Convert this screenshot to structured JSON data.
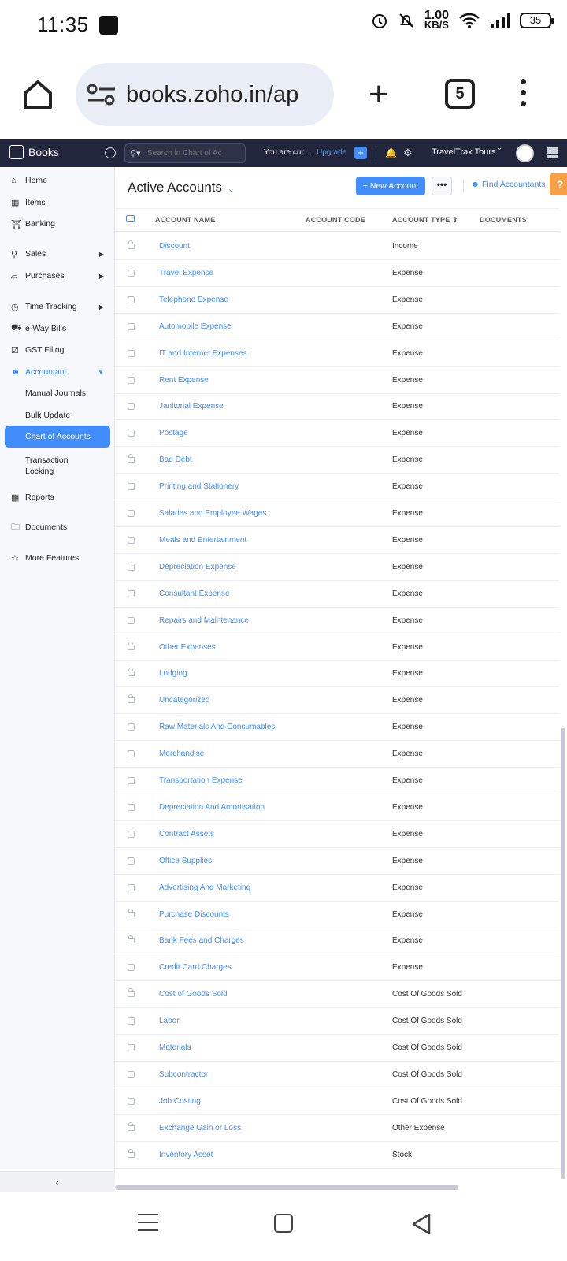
{
  "status_bar": {
    "time": "11:35",
    "speed_top": "1.00",
    "speed_unit": "KB/S",
    "battery": "35"
  },
  "browser": {
    "url": "books.zoho.in/ap",
    "tab_count": "5"
  },
  "app_header": {
    "app_name": "Books",
    "search_placeholder": "Search in Chart of Ac",
    "trial_text": "You are cur...",
    "upgrade_label": "Upgrade",
    "org_name": "TravelTrax Tours"
  },
  "sidebar": {
    "items": [
      {
        "label": "Home",
        "icon": "home-icon"
      },
      {
        "label": "Items",
        "icon": "items-icon"
      },
      {
        "label": "Banking",
        "icon": "bank-icon"
      },
      {
        "label": "Sales",
        "icon": "cart-icon"
      },
      {
        "label": "Purchases",
        "icon": "bag-icon"
      },
      {
        "label": "Time Tracking",
        "icon": "clock-icon"
      },
      {
        "label": "e-Way Bills",
        "icon": "truck-icon"
      },
      {
        "label": "GST Filing",
        "icon": "gst-icon"
      },
      {
        "label": "Accountant",
        "icon": "accountant-icon"
      },
      {
        "label": "Manual Journals"
      },
      {
        "label": "Bulk Update"
      },
      {
        "label": "Chart of Accounts"
      },
      {
        "label": "Transaction Locking"
      },
      {
        "label": "Reports",
        "icon": "reports-icon"
      },
      {
        "label": "Documents",
        "icon": "folder-icon"
      },
      {
        "label": "More Features",
        "icon": "star-icon"
      }
    ]
  },
  "main": {
    "title": "Active Accounts",
    "new_account_label": "+ New Account",
    "more_label": "•••",
    "find_accountants_label": "Find Accountants",
    "help_label": "?",
    "columns": [
      "ACCOUNT NAME",
      "ACCOUNT CODE",
      "ACCOUNT TYPE",
      "DOCUMENTS"
    ],
    "rows": [
      {
        "name": "Discount",
        "type": "Income",
        "locked": true
      },
      {
        "name": "Travel Expense",
        "type": "Expense",
        "locked": false
      },
      {
        "name": "Telephone Expense",
        "type": "Expense",
        "locked": false
      },
      {
        "name": "Automobile Expense",
        "type": "Expense",
        "locked": false
      },
      {
        "name": "IT and Internet Expenses",
        "type": "Expense",
        "locked": false
      },
      {
        "name": "Rent Expense",
        "type": "Expense",
        "locked": false
      },
      {
        "name": "Janitorial Expense",
        "type": "Expense",
        "locked": false
      },
      {
        "name": "Postage",
        "type": "Expense",
        "locked": false
      },
      {
        "name": "Bad Debt",
        "type": "Expense",
        "locked": true
      },
      {
        "name": "Printing and Stationery",
        "type": "Expense",
        "locked": false
      },
      {
        "name": "Salaries and Employee Wages",
        "type": "Expense",
        "locked": false
      },
      {
        "name": "Meals and Entertainment",
        "type": "Expense",
        "locked": false
      },
      {
        "name": "Depreciation Expense",
        "type": "Expense",
        "locked": false
      },
      {
        "name": "Consultant Expense",
        "type": "Expense",
        "locked": false
      },
      {
        "name": "Repairs and Maintenance",
        "type": "Expense",
        "locked": false
      },
      {
        "name": "Other Expenses",
        "type": "Expense",
        "locked": true
      },
      {
        "name": "Lodging",
        "type": "Expense",
        "locked": true
      },
      {
        "name": "Uncategorized",
        "type": "Expense",
        "locked": true
      },
      {
        "name": "Raw Materials And Consumables",
        "type": "Expense",
        "locked": false
      },
      {
        "name": "Merchandise",
        "type": "Expense",
        "locked": false
      },
      {
        "name": "Transportation Expense",
        "type": "Expense",
        "locked": false
      },
      {
        "name": "Depreciation And Amortisation",
        "type": "Expense",
        "locked": false
      },
      {
        "name": "Contract Assets",
        "type": "Expense",
        "locked": false
      },
      {
        "name": "Office Supplies",
        "type": "Expense",
        "locked": false
      },
      {
        "name": "Advertising And Marketing",
        "type": "Expense",
        "locked": false
      },
      {
        "name": "Purchase Discounts",
        "type": "Expense",
        "locked": true
      },
      {
        "name": "Bank Fees and Charges",
        "type": "Expense",
        "locked": true
      },
      {
        "name": "Credit Card Charges",
        "type": "Expense",
        "locked": false
      },
      {
        "name": "Cost of Goods Sold",
        "type": "Cost Of Goods Sold",
        "locked": true
      },
      {
        "name": "Labor",
        "type": "Cost Of Goods Sold",
        "locked": false
      },
      {
        "name": "Materials",
        "type": "Cost Of Goods Sold",
        "locked": false
      },
      {
        "name": "Subcontractor",
        "type": "Cost Of Goods Sold",
        "locked": false
      },
      {
        "name": "Job Costing",
        "type": "Cost Of Goods Sold",
        "locked": false
      },
      {
        "name": "Exchange Gain or Loss",
        "type": "Other Expense",
        "locked": true
      },
      {
        "name": "Inventory Asset",
        "type": "Stock",
        "locked": true
      }
    ]
  },
  "colors": {
    "accent": "#408dfb",
    "header_bg": "#21263c",
    "help": "#f7a046"
  }
}
